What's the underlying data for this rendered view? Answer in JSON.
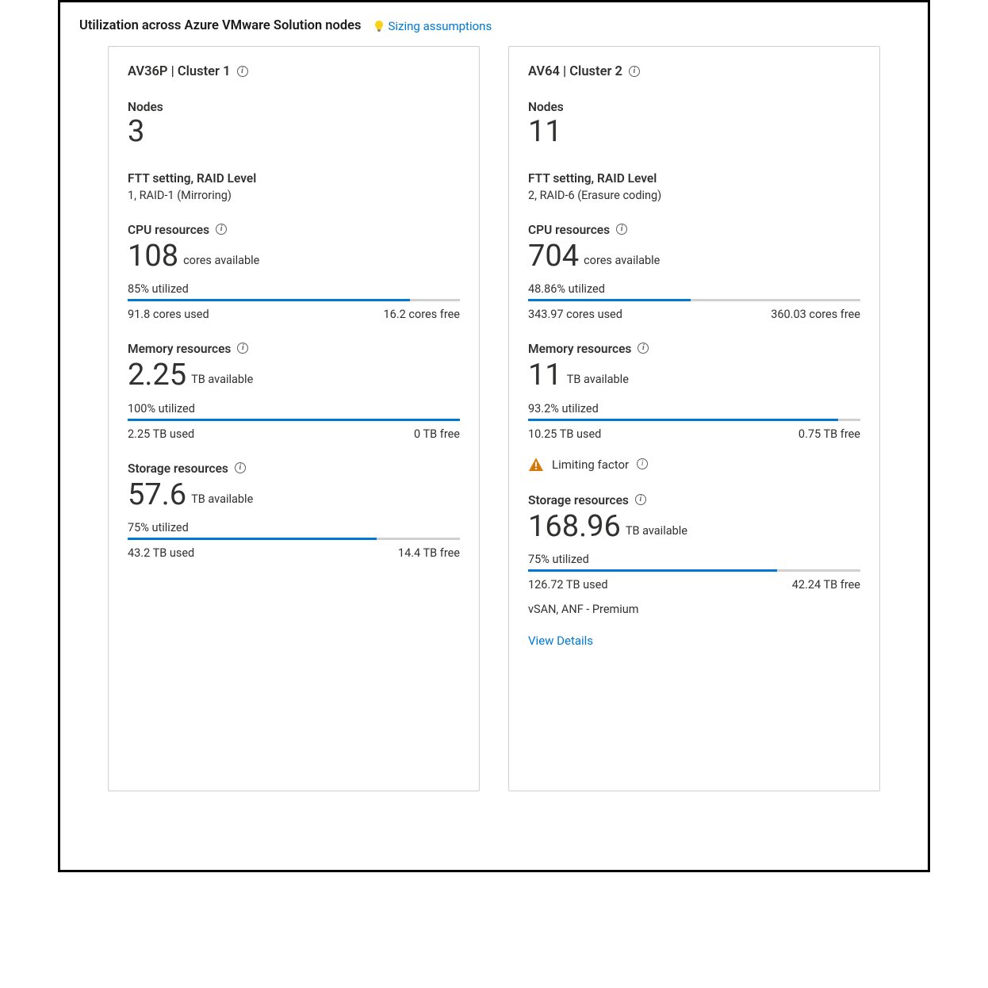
{
  "header": {
    "title": "Utilization across Azure VMware Solution nodes",
    "assumptions_label": "Sizing assumptions"
  },
  "labels": {
    "nodes": "Nodes",
    "ftt": "FTT setting, RAID Level",
    "cpu": "CPU resources",
    "mem": "Memory resources",
    "sto": "Storage resources",
    "limiting": "Limiting factor",
    "view_details": "View Details"
  },
  "clusters": [
    {
      "title": "AV36P | Cluster 1",
      "nodes": "3",
      "ftt_value": "1, RAID-1 (Mirroring)",
      "cpu": {
        "big": "108",
        "suffix": "cores available",
        "util": "85% utilized",
        "pct": 85,
        "used": "91.8 cores used",
        "free": "16.2 cores free"
      },
      "mem": {
        "big": "2.25",
        "suffix": "TB available",
        "util": "100% utilized",
        "pct": 100,
        "used": "2.25 TB used",
        "free": "0 TB free"
      },
      "sto": {
        "big": "57.6",
        "suffix": "TB available",
        "util": "75% utilized",
        "pct": 75,
        "used": "43.2 TB used",
        "free": "14.4 TB free"
      },
      "limiting": false,
      "footnote": null,
      "view_details": false
    },
    {
      "title": "AV64 | Cluster 2",
      "nodes": "11",
      "ftt_value": "2, RAID-6 (Erasure coding)",
      "cpu": {
        "big": "704",
        "suffix": "cores available",
        "util": "48.86% utilized",
        "pct": 48.86,
        "used": "343.97 cores used",
        "free": "360.03 cores free"
      },
      "mem": {
        "big": "11",
        "suffix": "TB available",
        "util": "93.2% utilized",
        "pct": 93.2,
        "used": "10.25 TB used",
        "free": "0.75 TB free"
      },
      "sto": {
        "big": "168.96",
        "suffix": "TB available",
        "util": "75% utilized",
        "pct": 75,
        "used": "126.72 TB used",
        "free": "42.24 TB free"
      },
      "limiting": true,
      "footnote": "vSAN, ANF - Premium",
      "view_details": true
    }
  ]
}
